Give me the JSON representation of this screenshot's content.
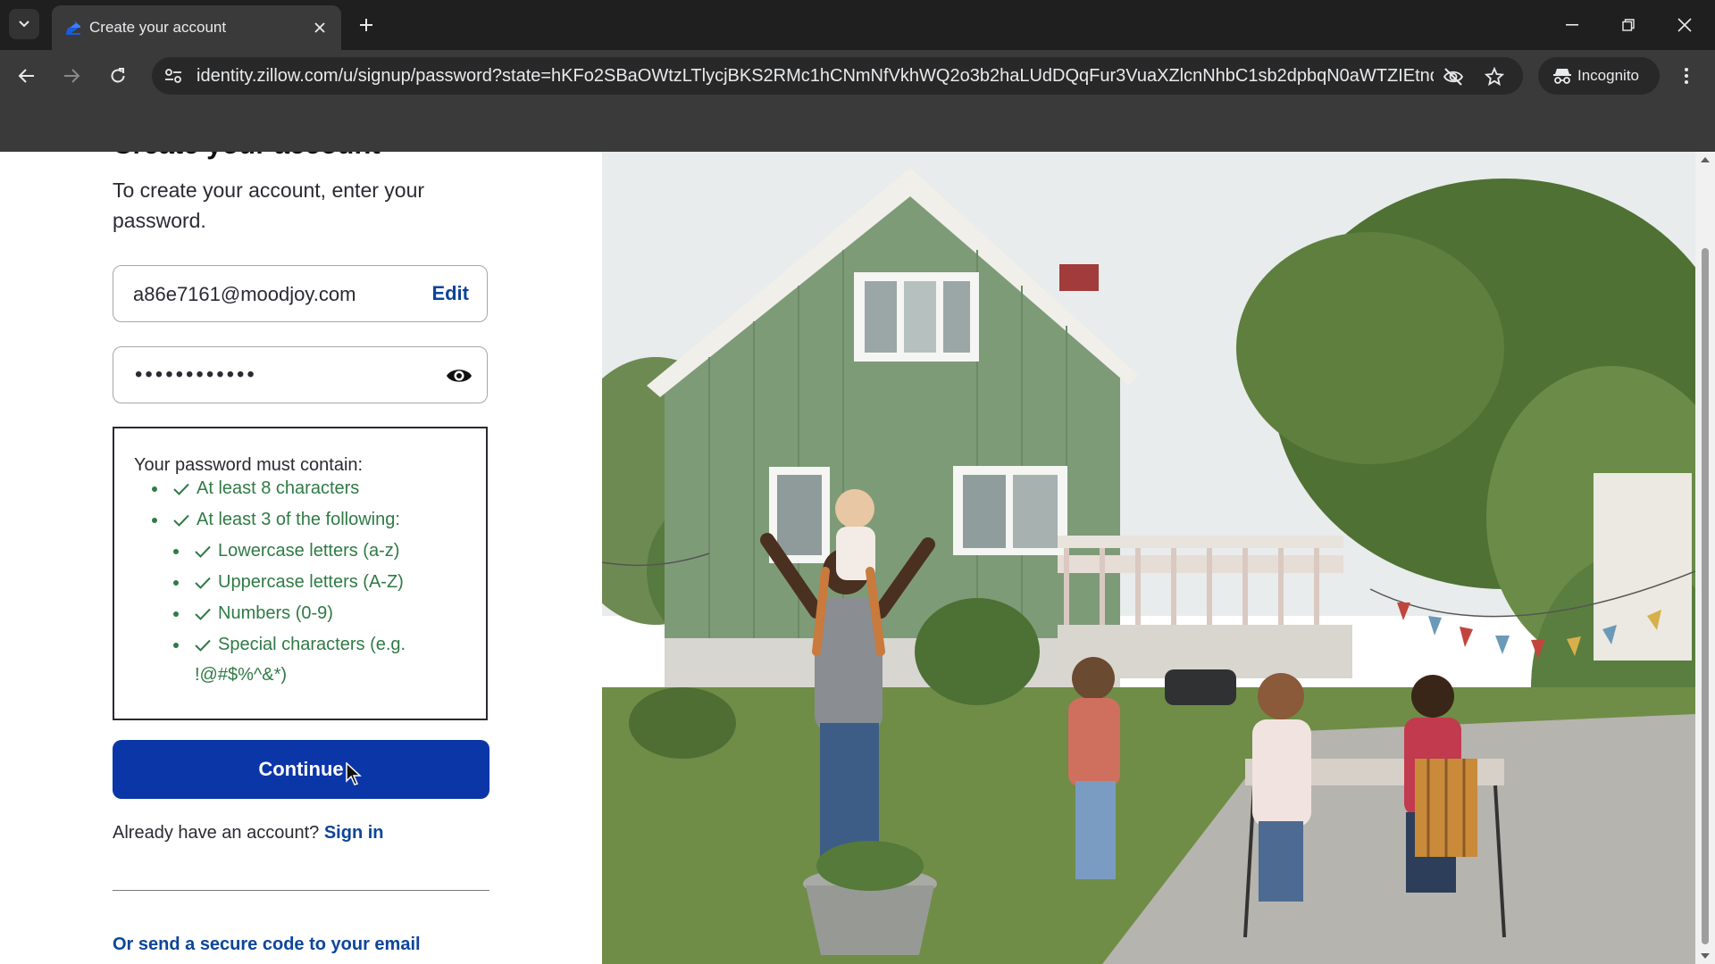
{
  "browser": {
    "tab_title": "Create your account",
    "url": "identity.zillow.com/u/signup/password?state=hKFo2SBaOWtzLTlycjBKS2RMc1hCNmNfVkhWQ2o3b2haLUdDQqFur3VuaXZlcnNhbC1sb2dpbqN0aWTZIEtndX...",
    "incognito_label": "Incognito",
    "icons": [
      "tab-list-icon",
      "zillow-favicon",
      "close-icon",
      "plus-icon",
      "minimize-icon",
      "restore-icon",
      "close-window-icon",
      "back-icon",
      "forward-icon",
      "reload-icon",
      "site-info-icon",
      "eye-off-icon",
      "star-icon",
      "incognito-icon",
      "more-icon"
    ]
  },
  "page": {
    "heading": "Create your account",
    "intro": "To create your account, enter your password.",
    "email": {
      "value": "a86e7161@moodjoy.com",
      "edit_label": "Edit"
    },
    "password": {
      "masked_value": "••••••••••••"
    },
    "requirements": {
      "title": "Your password must contain:",
      "items": [
        "At least 8 characters",
        "At least 3 of the following:",
        "Lowercase letters (a-z)",
        "Uppercase letters (A-Z)",
        "Numbers (0-9)",
        "Special characters (e.g.",
        "!@#$%^&*)"
      ]
    },
    "continue_label": "Continue",
    "signin_prompt": "Already have an account?",
    "signin_label": "Sign in",
    "code_link": "Or send a secure code to your email"
  },
  "colors": {
    "primary_button": "#0b36a8",
    "link": "#0d4599",
    "success": "#2f7a45",
    "chrome_dark": "#1f1f1f",
    "chrome_toolbar": "#3a3a3a"
  }
}
